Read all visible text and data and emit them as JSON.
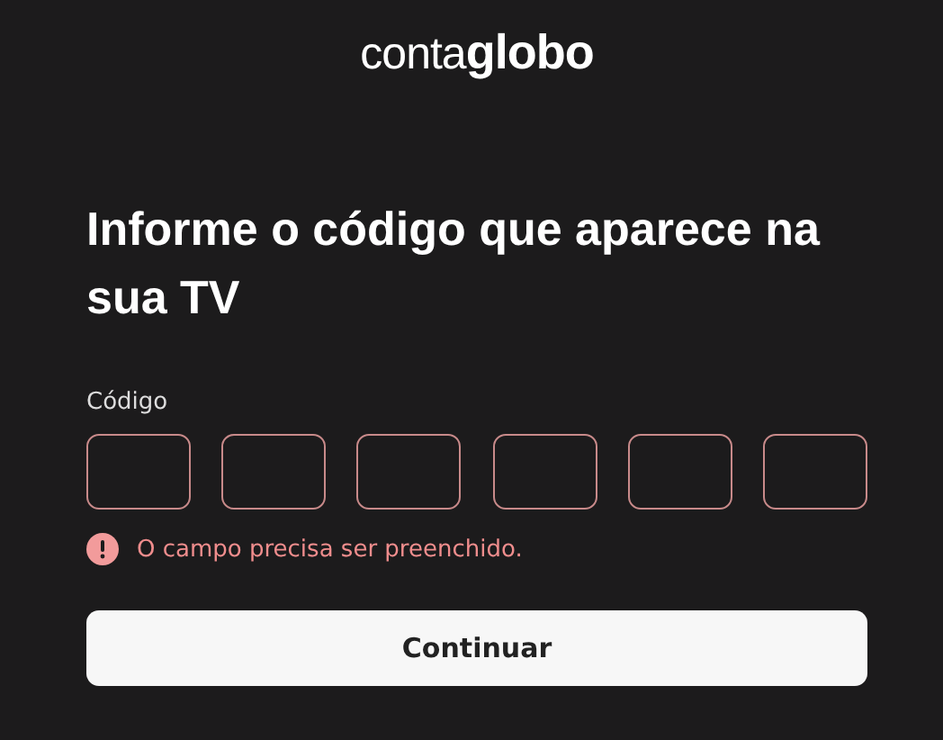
{
  "logo": "conta**globo**",
  "heading": "Informe o código que aparece na sua TV",
  "code": {
    "label": "Código",
    "boxes": [
      {
        "invalid": true
      },
      {
        "invalid": true
      },
      {
        "invalid": true
      },
      {
        "invalid": true
      },
      {
        "invalid": true
      },
      {
        "invalid": true
      }
    ],
    "error": "O campo precisa ser preenchido."
  },
  "button": "Continuar"
}
